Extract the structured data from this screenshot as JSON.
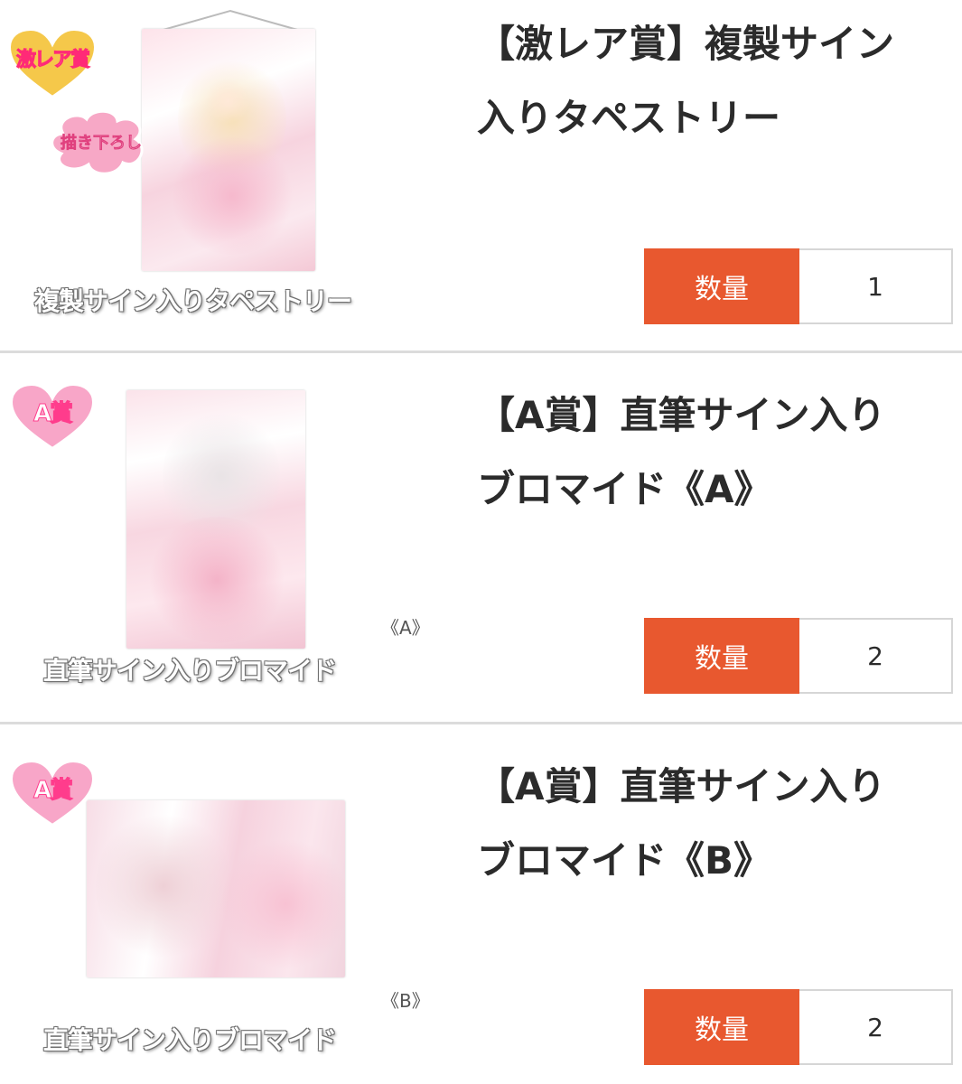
{
  "accent_color": "#e8582f",
  "items": [
    {
      "badge": "激レア賞",
      "sub_badge": "描き下ろし",
      "caption": "複製サイン入りタペストリー",
      "variant": "",
      "title_line1": "【激レア賞】複製サイン",
      "title_line2": "入りタペストリー",
      "qty_label": "数量",
      "qty_value": "1"
    },
    {
      "badge": "A賞",
      "caption": "直筆サイン入りブロマイド",
      "variant": "《A》",
      "title_line1": "【A賞】直筆サイン入り",
      "title_line2": "ブロマイド《A》",
      "qty_label": "数量",
      "qty_value": "2"
    },
    {
      "badge": "A賞",
      "caption": "直筆サイン入りブロマイド",
      "variant": "《B》",
      "title_line1": "【A賞】直筆サイン入り",
      "title_line2": "ブロマイド《B》",
      "qty_label": "数量",
      "qty_value": "2"
    }
  ]
}
